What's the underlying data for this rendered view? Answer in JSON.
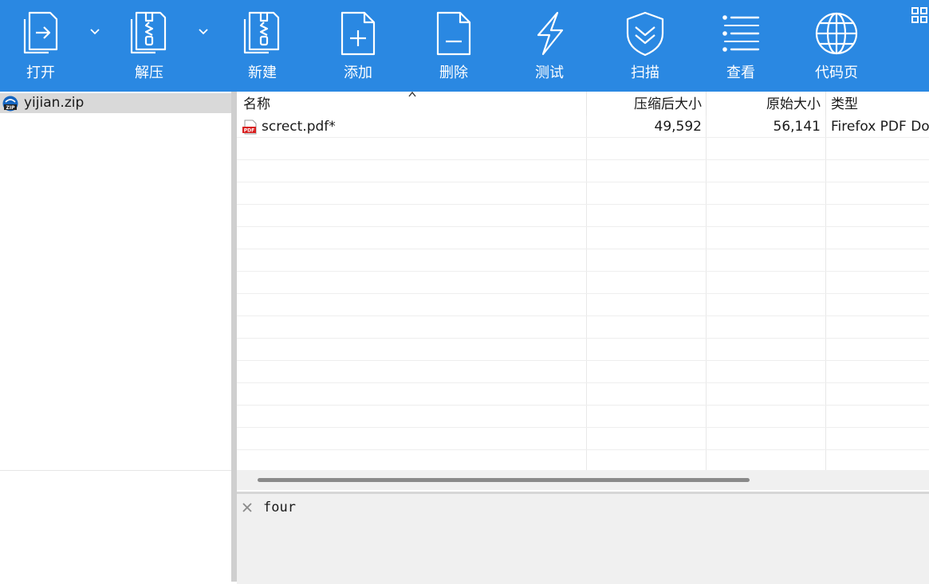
{
  "toolbar": {
    "background": "#2a88e2",
    "items": [
      {
        "label": "打开",
        "icon": "open-icon"
      },
      {
        "label": "解压",
        "icon": "extract-icon"
      },
      {
        "label": "新建",
        "icon": "new-archive-icon"
      },
      {
        "label": "添加",
        "icon": "add-file-icon"
      },
      {
        "label": "删除",
        "icon": "delete-file-icon"
      },
      {
        "label": "测试",
        "icon": "test-icon"
      },
      {
        "label": "扫描",
        "icon": "scan-shield-icon"
      },
      {
        "label": "查看",
        "icon": "view-list-icon"
      },
      {
        "label": "代码页",
        "icon": "codepage-globe-icon"
      }
    ]
  },
  "tree": {
    "items": [
      {
        "label": "yijian.zip",
        "icon": "zip-icon"
      }
    ]
  },
  "file_list": {
    "columns": [
      "名称",
      "压缩后大小",
      "原始大小",
      "类型"
    ],
    "rows": [
      {
        "name": "screct.pdf*",
        "packed": "49,592",
        "original": "56,141",
        "type": "Firefox PDF Document",
        "icon": "pdf-icon"
      }
    ]
  },
  "comment": {
    "text": "four"
  }
}
